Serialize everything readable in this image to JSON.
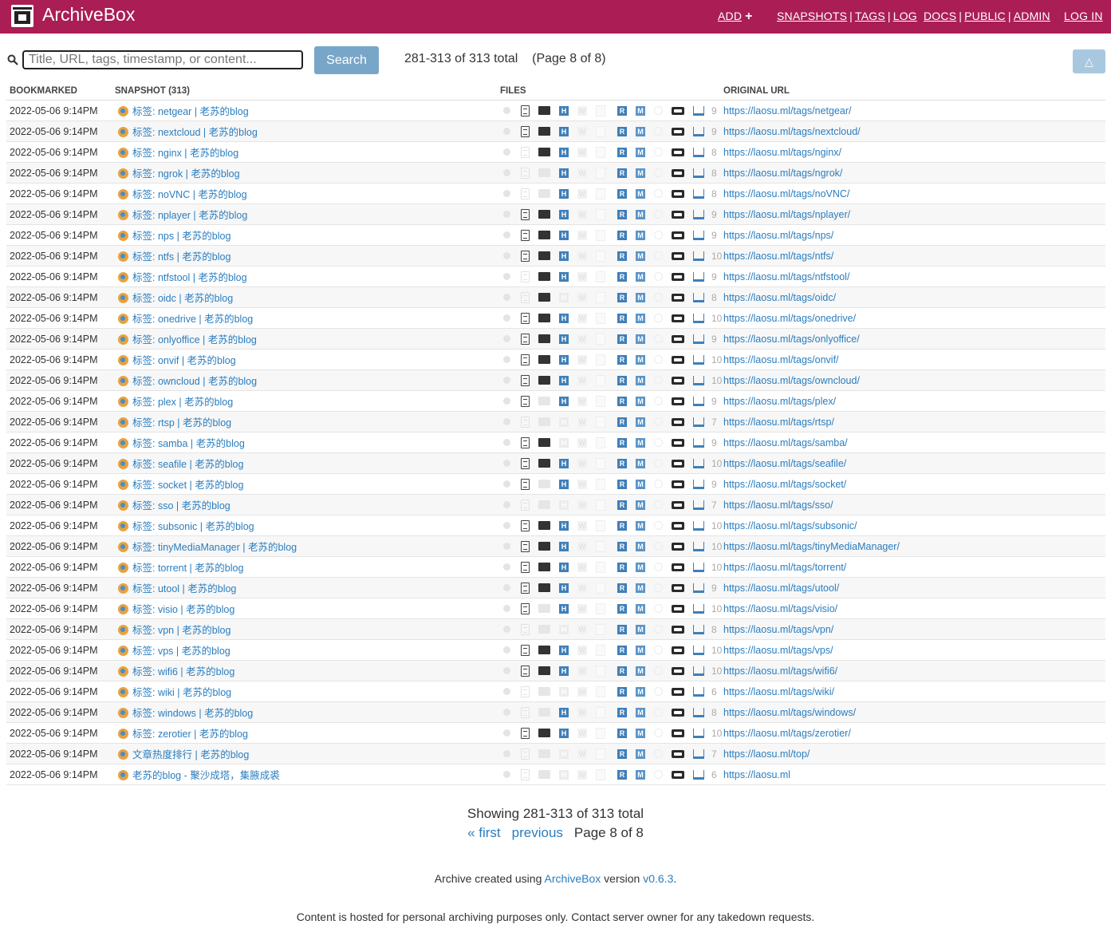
{
  "header": {
    "brand": "ArchiveBox",
    "nav": {
      "add": "ADD",
      "snapshots": "SNAPSHOTS",
      "tags": "TAGS",
      "log": "LOG",
      "docs": "DOCS",
      "public": "PUBLIC",
      "admin": "ADMIN",
      "login": "LOG IN"
    },
    "bg_color": "#aa1e55"
  },
  "search": {
    "placeholder": "Title, URL, tags, timestamp, or content...",
    "button": "Search",
    "count": "281-313 of 313 total    (Page 8 of 8)",
    "scroll_icon": "up-triangle-icon"
  },
  "table": {
    "headers": {
      "bookmarked": "BOOKMARKED",
      "snapshot": "SNAPSHOT (313)",
      "files": "FILES",
      "url": "ORIGINAL URL"
    },
    "rows": [
      {
        "date": "2022-05-06 9:14PM",
        "title": "标签: netgear | 老苏的blog",
        "url": "https://laosu.ml/tags/netgear/",
        "count": "9",
        "flags": "1111111"
      },
      {
        "date": "2022-05-06 9:14PM",
        "title": "标签: nextcloud | 老苏的blog",
        "url": "https://laosu.ml/tags/nextcloud/",
        "count": "9",
        "flags": "1111111"
      },
      {
        "date": "2022-05-06 9:14PM",
        "title": "标签: nginx | 老苏的blog",
        "url": "https://laosu.ml/tags/nginx/",
        "count": "8",
        "flags": "0111111"
      },
      {
        "date": "2022-05-06 9:14PM",
        "title": "标签: ngrok | 老苏的blog",
        "url": "https://laosu.ml/tags/ngrok/",
        "count": "8",
        "flags": "0011111"
      },
      {
        "date": "2022-05-06 9:14PM",
        "title": "标签: noVNC | 老苏的blog",
        "url": "https://laosu.ml/tags/noVNC/",
        "count": "8",
        "flags": "0011111"
      },
      {
        "date": "2022-05-06 9:14PM",
        "title": "标签: nplayer | 老苏的blog",
        "url": "https://laosu.ml/tags/nplayer/",
        "count": "9",
        "flags": "1111111"
      },
      {
        "date": "2022-05-06 9:14PM",
        "title": "标签: nps | 老苏的blog",
        "url": "https://laosu.ml/tags/nps/",
        "count": "9",
        "flags": "1111111"
      },
      {
        "date": "2022-05-06 9:14PM",
        "title": "标签: ntfs | 老苏的blog",
        "url": "https://laosu.ml/tags/ntfs/",
        "count": "10",
        "flags": "1111111"
      },
      {
        "date": "2022-05-06 9:14PM",
        "title": "标签: ntfstool | 老苏的blog",
        "url": "https://laosu.ml/tags/ntfstool/",
        "count": "9",
        "flags": "0111111"
      },
      {
        "date": "2022-05-06 9:14PM",
        "title": "标签: oidc | 老苏的blog",
        "url": "https://laosu.ml/tags/oidc/",
        "count": "8",
        "flags": "0101111"
      },
      {
        "date": "2022-05-06 9:14PM",
        "title": "标签: onedrive | 老苏的blog",
        "url": "https://laosu.ml/tags/onedrive/",
        "count": "10",
        "flags": "1111111"
      },
      {
        "date": "2022-05-06 9:14PM",
        "title": "标签: onlyoffice | 老苏的blog",
        "url": "https://laosu.ml/tags/onlyoffice/",
        "count": "9",
        "flags": "1111111"
      },
      {
        "date": "2022-05-06 9:14PM",
        "title": "标签: onvif | 老苏的blog",
        "url": "https://laosu.ml/tags/onvif/",
        "count": "10",
        "flags": "1111111"
      },
      {
        "date": "2022-05-06 9:14PM",
        "title": "标签: owncloud | 老苏的blog",
        "url": "https://laosu.ml/tags/owncloud/",
        "count": "10",
        "flags": "1111111"
      },
      {
        "date": "2022-05-06 9:14PM",
        "title": "标签: plex | 老苏的blog",
        "url": "https://laosu.ml/tags/plex/",
        "count": "9",
        "flags": "1011111"
      },
      {
        "date": "2022-05-06 9:14PM",
        "title": "标签: rtsp | 老苏的blog",
        "url": "https://laosu.ml/tags/rtsp/",
        "count": "7",
        "flags": "0001111"
      },
      {
        "date": "2022-05-06 9:14PM",
        "title": "标签: samba | 老苏的blog",
        "url": "https://laosu.ml/tags/samba/",
        "count": "9",
        "flags": "1101111"
      },
      {
        "date": "2022-05-06 9:14PM",
        "title": "标签: seafile | 老苏的blog",
        "url": "https://laosu.ml/tags/seafile/",
        "count": "10",
        "flags": "1111111"
      },
      {
        "date": "2022-05-06 9:14PM",
        "title": "标签: socket | 老苏的blog",
        "url": "https://laosu.ml/tags/socket/",
        "count": "9",
        "flags": "1011111"
      },
      {
        "date": "2022-05-06 9:14PM",
        "title": "标签: sso | 老苏的blog",
        "url": "https://laosu.ml/tags/sso/",
        "count": "7",
        "flags": "0001111"
      },
      {
        "date": "2022-05-06 9:14PM",
        "title": "标签: subsonic | 老苏的blog",
        "url": "https://laosu.ml/tags/subsonic/",
        "count": "10",
        "flags": "1111111"
      },
      {
        "date": "2022-05-06 9:14PM",
        "title": "标签: tinyMediaManager | 老苏的blog",
        "url": "https://laosu.ml/tags/tinyMediaManager/",
        "count": "10",
        "flags": "1111111"
      },
      {
        "date": "2022-05-06 9:14PM",
        "title": "标签: torrent | 老苏的blog",
        "url": "https://laosu.ml/tags/torrent/",
        "count": "10",
        "flags": "1111111"
      },
      {
        "date": "2022-05-06 9:14PM",
        "title": "标签: utool | 老苏的blog",
        "url": "https://laosu.ml/tags/utool/",
        "count": "9",
        "flags": "1111111"
      },
      {
        "date": "2022-05-06 9:14PM",
        "title": "标签: visio | 老苏的blog",
        "url": "https://laosu.ml/tags/visio/",
        "count": "10",
        "flags": "1011111"
      },
      {
        "date": "2022-05-06 9:14PM",
        "title": "标签: vpn | 老苏的blog",
        "url": "https://laosu.ml/tags/vpn/",
        "count": "8",
        "flags": "0001111"
      },
      {
        "date": "2022-05-06 9:14PM",
        "title": "标签: vps | 老苏的blog",
        "url": "https://laosu.ml/tags/vps/",
        "count": "10",
        "flags": "1111111"
      },
      {
        "date": "2022-05-06 9:14PM",
        "title": "标签: wifi6 | 老苏的blog",
        "url": "https://laosu.ml/tags/wifi6/",
        "count": "10",
        "flags": "1111111"
      },
      {
        "date": "2022-05-06 9:14PM",
        "title": "标签: wiki | 老苏的blog",
        "url": "https://laosu.ml/tags/wiki/",
        "count": "6",
        "flags": "0001111"
      },
      {
        "date": "2022-05-06 9:14PM",
        "title": "标签: windows | 老苏的blog",
        "url": "https://laosu.ml/tags/windows/",
        "count": "8",
        "flags": "0011111"
      },
      {
        "date": "2022-05-06 9:14PM",
        "title": "标签: zerotier | 老苏的blog",
        "url": "https://laosu.ml/tags/zerotier/",
        "count": "10",
        "flags": "1111111"
      },
      {
        "date": "2022-05-06 9:14PM",
        "title": "文章热度排行 | 老苏的blog",
        "url": "https://laosu.ml/top/",
        "count": "7",
        "flags": "0001111"
      },
      {
        "date": "2022-05-06 9:14PM",
        "title": "老苏的blog - 聚沙成塔，集腋成裘",
        "url": "https://laosu.ml",
        "count": "6",
        "flags": "0000101"
      }
    ]
  },
  "footer": {
    "showing": "Showing 281-313 of 313 total",
    "first": "« first",
    "previous": "previous",
    "page": "Page 8 of 8",
    "credit_prefix": "Archive created using ",
    "credit_link": "ArchiveBox",
    "credit_mid": " version ",
    "version": "v0.6.3",
    "credit_suffix": ".",
    "notice": "Content is hosted for personal archiving purposes only. Contact server owner for any takedown requests."
  }
}
